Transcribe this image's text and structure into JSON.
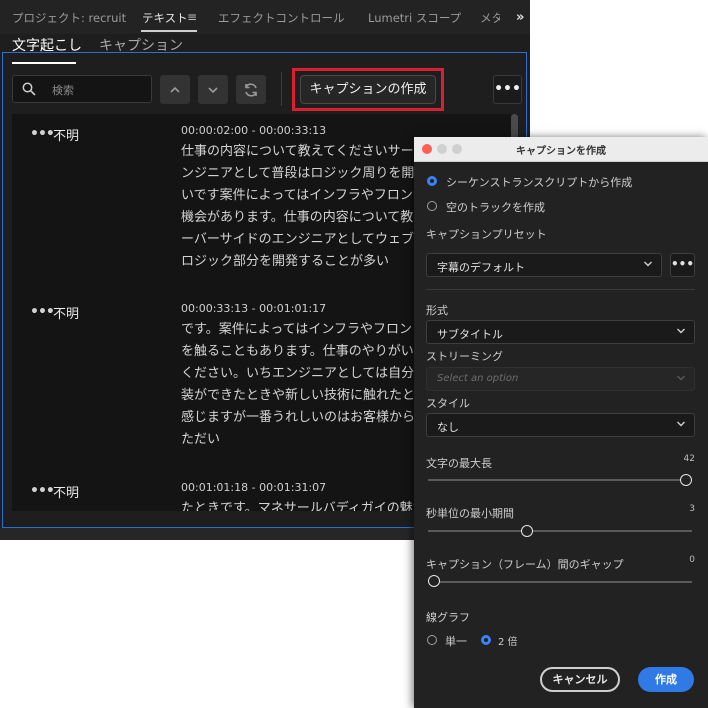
{
  "panel": {
    "tabs": [
      {
        "label": "プロジェクト: recruit"
      },
      {
        "label": "テキスト"
      },
      {
        "label": "エフェクトコントロール"
      },
      {
        "label": "Lumetri スコープ"
      },
      {
        "label": "メタ"
      }
    ],
    "overflow": "»",
    "subtabs": [
      {
        "label": "文字起こし"
      },
      {
        "label": "キャプション"
      }
    ],
    "search": {
      "placeholder": "検索"
    },
    "create_caption_label": "キャプションの作成",
    "more_label": "•••"
  },
  "transcript": {
    "segments": [
      {
        "speaker": "不明",
        "time": "00:00:02:00 - 00:00:33:13",
        "lines": [
          "仕事の内容について教えてくださいサー",
          "ンジニアとして普段はロジック周りを開発",
          "いです案件によってはインフラやフロン",
          "機会があります。仕事の内容について教",
          "ーバーサイドのエンジニアとしてウェブサ",
          "ロジック部分を開発することが多い"
        ]
      },
      {
        "speaker": "不明",
        "time": "00:00:33:13 - 00:01:01:17",
        "lines": [
          "です。案件によってはインフラやフロン",
          "を触ることもあります。仕事のやりがい",
          "ください。いちエンジニアとしては自分の",
          "装ができたときや新しい技術に触れたと",
          "感じますが一番うれしいのはお客様から",
          "ただい"
        ]
      },
      {
        "speaker": "不明",
        "time": "00:01:01:18 - 00:01:31:07",
        "lines": [
          "たときです。マネサールバディガイの魅力"
        ]
      }
    ]
  },
  "dialog": {
    "title": "キャプションを作成",
    "source_options": [
      {
        "label": "シーケンストランスクリプトから作成",
        "selected": true
      },
      {
        "label": "空のトラックを作成",
        "selected": false
      }
    ],
    "preset_label": "キャプションプリセット",
    "preset_value": "字幕のデフォルト",
    "preset_more": "•••",
    "format_label": "形式",
    "format_value": "サブタイトル",
    "streaming_label": "ストリーミング",
    "streaming_placeholder": "Select an option",
    "style_label": "スタイル",
    "style_value": "なし",
    "sliders": [
      {
        "label": "文字の最大長",
        "value": "42",
        "fraction": 1.0
      },
      {
        "label": "秒単位の最小期間",
        "value": "3",
        "fraction": 0.37
      },
      {
        "label": "キャプション（フレーム）間のギャップ",
        "value": "0",
        "fraction": 0.0
      }
    ],
    "lines_label": "線グラフ",
    "lines_options": [
      {
        "label": "単一",
        "selected": false
      },
      {
        "label": "2 倍",
        "selected": true
      }
    ],
    "cancel_label": "キャンセル",
    "create_label": "作成"
  },
  "colors": {
    "accent": "#2f7ae5",
    "highlight": "#d8212f",
    "squiggle": "#e08a2c"
  }
}
